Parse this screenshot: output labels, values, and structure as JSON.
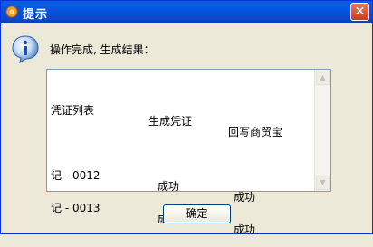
{
  "window": {
    "title": "提示"
  },
  "dialog": {
    "message": "操作完成, 生成结果：",
    "ok_label": "确定"
  },
  "results": {
    "headers": [
      "凭证列表",
      "生成凭证",
      "回写商贸宝"
    ],
    "rows": [
      [
        "记 - 0012",
        "成功",
        "成功"
      ],
      [
        "记 - 0013",
        "成功",
        "成功"
      ]
    ]
  },
  "icons": {
    "app": "app-icon",
    "info": "info-icon",
    "close": "close-icon"
  },
  "colors": {
    "titlebar": "#0555e0",
    "dialog_bg": "#ece9d8",
    "close": "#d25a38"
  }
}
